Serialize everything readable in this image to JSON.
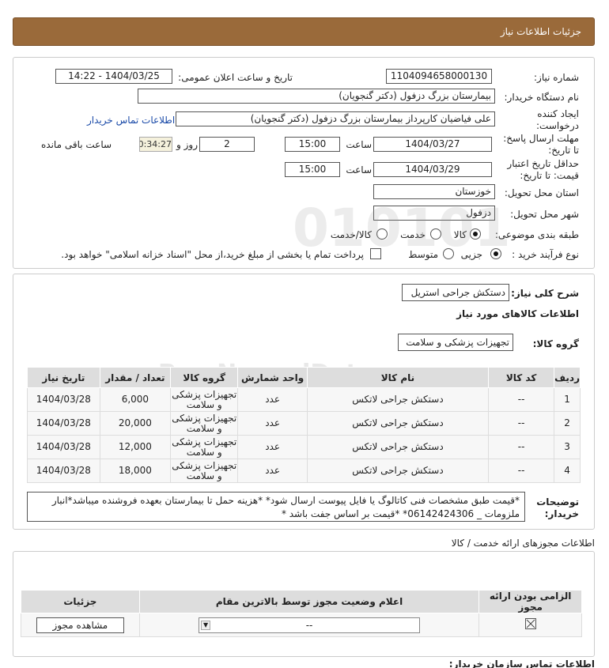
{
  "header": {
    "title": "جزئیات اطلاعات نیاز"
  },
  "form": {
    "need_number_label": "شماره نیاز:",
    "need_number": "1104094658000130",
    "announce_label": "تاریخ و ساعت اعلان عمومی:",
    "announce_value": "1404/03/25 - 14:22",
    "buyer_org_label": "نام دستگاه خریدار:",
    "buyer_org": "بیمارستان بزرگ دزفول (دکتر گنجویان)",
    "creator_label_1": "ایجاد کننده",
    "creator_label_2": "درخواست:",
    "creator": "علی فیاضیان کارپرداز بیمارستان بزرگ دزفول (دکتر گنجویان)",
    "contact_link": "اطلاعات تماس خریدار",
    "deadline_label_1": "مهلت ارسال پاسخ:",
    "deadline_label_2": "تا تاریخ:",
    "deadline_date": "1404/03/27",
    "time_label": "ساعت",
    "deadline_time": "15:00",
    "days_value": "2",
    "days_label": "روز و",
    "timer": "00:34:27",
    "remaining_label": "ساعت باقی مانده",
    "validity_label_1": "حداقل تاریخ اعتبار",
    "validity_label_2": "قیمت: تا تاریخ:",
    "validity_date": "1404/03/29",
    "validity_time": "15:00",
    "province_label": "استان محل تحویل:",
    "province": "خوزستان",
    "city_label": "شهر محل تحویل:",
    "city": "دزفول",
    "category_label": "طبقه بندی موضوعی:",
    "category_options": [
      "کالا",
      "خدمت",
      "کالا/خدمت"
    ],
    "process_label": "نوع فرآیند خرید :",
    "process_options": [
      "جزیی",
      "متوسط"
    ],
    "treasury_note": "پرداخت تمام یا بخشی از مبلغ خرید،از محل \"اسناد خزانه اسلامی\" خواهد بود."
  },
  "summary": {
    "label": "شرح کلی نیاز:",
    "value": "دستکش جراحی استریل",
    "goods_info_title": "اطلاعات کالاهای مورد نیاز",
    "group_label": "گروه کالا:",
    "group_value": "تجهیزات پزشکی و سلامت"
  },
  "items_table": {
    "headers": [
      "ردیف",
      "کد کالا",
      "نام کالا",
      "واحد شمارش",
      "گروه کالا",
      "تعداد / مقدار",
      "تاریخ نیاز"
    ],
    "rows": [
      {
        "idx": "1",
        "code": "--",
        "name": "دستکش جراحی لاتکس",
        "unit": "عدد",
        "group": "تجهیزات پزشکی و سلامت",
        "qty": "6,000",
        "date": "1404/03/28"
      },
      {
        "idx": "2",
        "code": "--",
        "name": "دستکش جراحی لاتکس",
        "unit": "عدد",
        "group": "تجهیزات پزشکی و سلامت",
        "qty": "20,000",
        "date": "1404/03/28"
      },
      {
        "idx": "3",
        "code": "--",
        "name": "دستکش جراحی لاتکس",
        "unit": "عدد",
        "group": "تجهیزات پزشکی و سلامت",
        "qty": "12,000",
        "date": "1404/03/28"
      },
      {
        "idx": "4",
        "code": "--",
        "name": "دستکش جراحی لاتکس",
        "unit": "عدد",
        "group": "تجهیزات پزشکی و سلامت",
        "qty": "18,000",
        "date": "1404/03/28"
      }
    ]
  },
  "notes": {
    "label_1": "توضیحات",
    "label_2": "خریدار:",
    "text": "*قیمت طبق مشخصات فنی کاتالوگ یا فایل پیوست ارسال شود* *هزینه حمل تا بیمارستان بعهده فروشنده میباشد*انبار ملزومات _ 06142424306* *قیمت بر اساس جفت باشد *"
  },
  "licenses": {
    "title": "اطلاعات مجوزهای ارائه خدمت / کالا",
    "headers": [
      "الزامی بودن ارائه مجوز",
      "اعلام وضعیت مجوز توسط بالاترین مقام",
      "جزئیات"
    ],
    "select_value": "--",
    "view_button": "مشاهده مجوز"
  },
  "footer": {
    "contact_title": "اطلاعات تماس سازمان خریدار:"
  },
  "watermark": {
    "brand": "ParsNamadData",
    "phone": "۰۲۱-۸۸۳۴۹۶۷۰-۵"
  }
}
